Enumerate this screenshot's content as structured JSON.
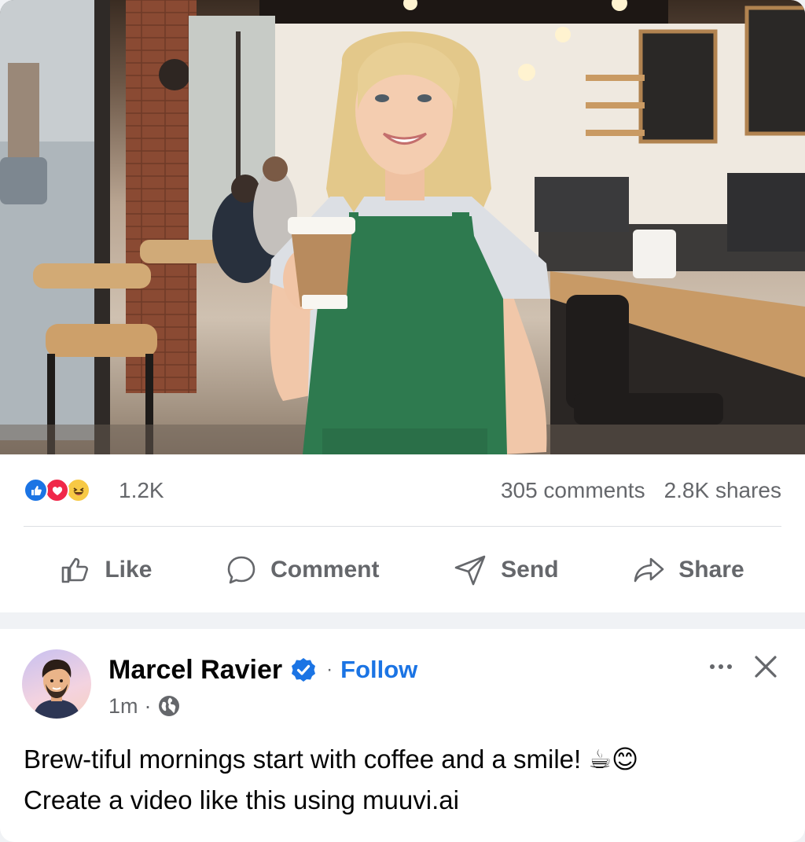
{
  "post": {
    "reactions": {
      "icons": [
        "like-icon",
        "love-icon",
        "haha-icon"
      ],
      "count": "1.2K"
    },
    "comments": "305 comments",
    "shares": "2.8K shares",
    "actions": {
      "like": "Like",
      "comment": "Comment",
      "send": "Send",
      "share": "Share"
    }
  },
  "next_post": {
    "author": "Marcel Ravier",
    "separator": "·",
    "follow": "Follow",
    "time": "1m",
    "time_separator": "·",
    "visibility_icon": "globe-icon",
    "caption_line1": "Brew-tiful mornings start with coffee and a smile! ☕😊",
    "caption_line2": "Create a video like this using muuvi.ai"
  },
  "colors": {
    "accent": "#1b74e4",
    "secondary_text": "#65676b",
    "apron": "#2e7a4f"
  }
}
